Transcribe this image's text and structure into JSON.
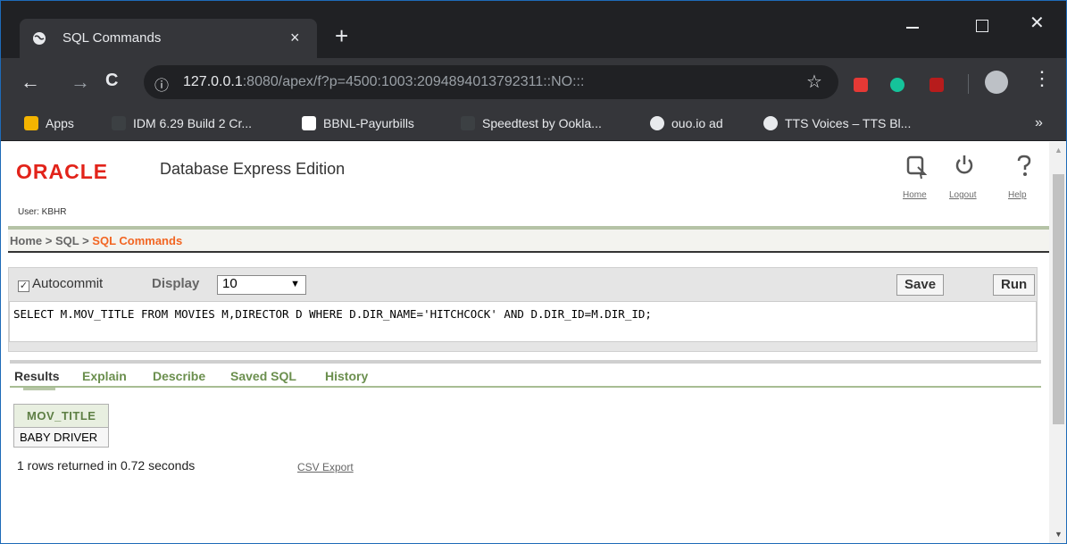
{
  "browser": {
    "tab_title": "SQL Commands",
    "tab_close": "×",
    "new_tab": "+",
    "url_info_icon": "ⓘ",
    "url_host": "127.0.0.1",
    "url_rest": ":8080/apex/f?p=4500:1003:2094894013792311::NO:::",
    "window_min": "—",
    "window_close": "✕",
    "back": "←",
    "forward": "→",
    "reload": "C",
    "star": "☆",
    "menu": "⋮",
    "bookmarks_more": "»",
    "bookmarks": [
      {
        "label": "Apps",
        "icon": "apps-grid-icon",
        "color": "#f4b400"
      },
      {
        "label": "IDM 6.29 Build 2 Cr...",
        "icon": "page-icon",
        "color": "#3c4043"
      },
      {
        "label": "BBNL-Payurbills",
        "icon": "bbnl-icon",
        "color": "#ffffff"
      },
      {
        "label": "Speedtest by Ookla...",
        "icon": "page-icon",
        "color": "#3c4043"
      },
      {
        "label": "ouo.io ad",
        "icon": "globe-icon",
        "color": "#e8eaed"
      },
      {
        "label": "TTS Voices – TTS Bl...",
        "icon": "globe-icon",
        "color": "#e8eaed"
      }
    ]
  },
  "header": {
    "logo": "ORACLE",
    "product": "Database Express Edition",
    "user": "User: KBHR",
    "links": {
      "home": "Home",
      "logout": "Logout",
      "help": "Help"
    }
  },
  "breadcrumb": {
    "home": "Home",
    "sep": " > ",
    "sql": "SQL",
    "current": "SQL Commands"
  },
  "panel": {
    "autocommit_label": "Autocommit",
    "autocommit_checked": true,
    "display_label": "Display",
    "display_value": "10",
    "save_label": "Save",
    "run_label": "Run",
    "sql_text": "SELECT M.MOV_TITLE FROM MOVIES M,DIRECTOR D WHERE D.DIR_NAME='HITCHCOCK' AND D.DIR_ID=M.DIR_ID;"
  },
  "result_tabs": [
    "Results",
    "Explain",
    "Describe",
    "Saved SQL",
    "History"
  ],
  "results": {
    "columns": [
      "MOV_TITLE"
    ],
    "rows": [
      [
        "BABY DRIVER"
      ]
    ],
    "summary": "1 rows returned in 0.72 seconds",
    "csv_export": "CSV Export"
  },
  "colors": {
    "oracle_red": "#e2231a",
    "crumb_orange": "#f26522",
    "tab_green": "#6b8f4e"
  }
}
